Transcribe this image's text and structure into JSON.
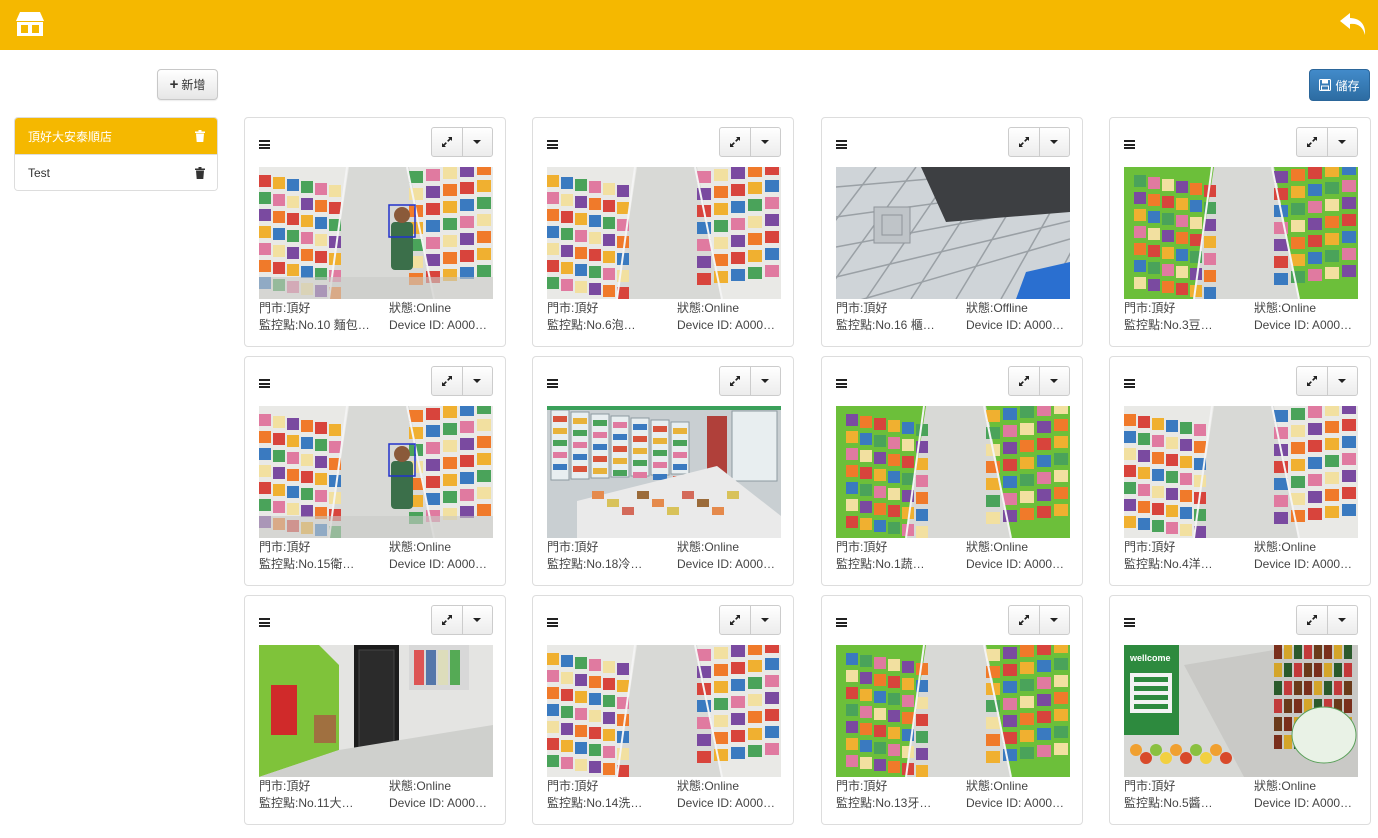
{
  "header": {
    "home_icon": "store-icon",
    "back_icon": "undo-arrow-icon",
    "color": "#f5b800"
  },
  "toolbar": {
    "add_label": "新增",
    "save_label": "儲存"
  },
  "stores": [
    {
      "name": "頂好大安泰順店",
      "active": true
    },
    {
      "name": "Test",
      "active": false
    }
  ],
  "cameras": [
    {
      "store": "門市:頂好",
      "status": "狀態:Online",
      "point": "監控點:No.10 麵包…",
      "device": "Device ID: A000…",
      "scene": "shelves-person"
    },
    {
      "store": "門市:頂好",
      "status": "狀態:Online",
      "point": "監控點:No.6泡…",
      "device": "Device ID: A000…",
      "scene": "aisle"
    },
    {
      "store": "門市:頂好",
      "status": "狀態:Offline",
      "point": "監控點:No.16 櫃…",
      "device": "Device ID: A000…",
      "scene": "ceiling"
    },
    {
      "store": "門市:頂好",
      "status": "狀態:Online",
      "point": "監控點:No.3豆…",
      "device": "Device ID: A000…",
      "scene": "green-aisle"
    },
    {
      "store": "門市:頂好",
      "status": "狀態:Online",
      "point": "監控點:No.15衛…",
      "device": "Device ID: A000…",
      "scene": "shelves-person"
    },
    {
      "store": "門市:頂好",
      "status": "狀態:Online",
      "point": "監控點:No.18冷…",
      "device": "Device ID: A000…",
      "scene": "fridges"
    },
    {
      "store": "門市:頂好",
      "status": "狀態:Online",
      "point": "監控點:No.1蔬…",
      "device": "Device ID: A000…",
      "scene": "green-aisle"
    },
    {
      "store": "門市:頂好",
      "status": "狀態:Online",
      "point": "監控點:No.4洋…",
      "device": "Device ID: A000…",
      "scene": "aisle"
    },
    {
      "store": "門市:頂好",
      "status": "狀態:Online",
      "point": "監控點:No.11大…",
      "device": "Device ID: A000…",
      "scene": "entrance"
    },
    {
      "store": "門市:頂好",
      "status": "狀態:Online",
      "point": "監控點:No.14洗…",
      "device": "Device ID: A000…",
      "scene": "aisle"
    },
    {
      "store": "門市:頂好",
      "status": "狀態:Online",
      "point": "監控點:No.13牙…",
      "device": "Device ID: A000…",
      "scene": "green-aisle"
    },
    {
      "store": "門市:頂好",
      "status": "狀態:Online",
      "point": "監控點:No.5醬…",
      "device": "Device ID: A000…",
      "scene": "wellcome-sign"
    }
  ],
  "signage": {
    "wellcome": "wellcome"
  },
  "card_icons": {
    "menu": "hamburger-icon",
    "expand": "expand-icon",
    "dropdown": "caret-down-icon"
  }
}
